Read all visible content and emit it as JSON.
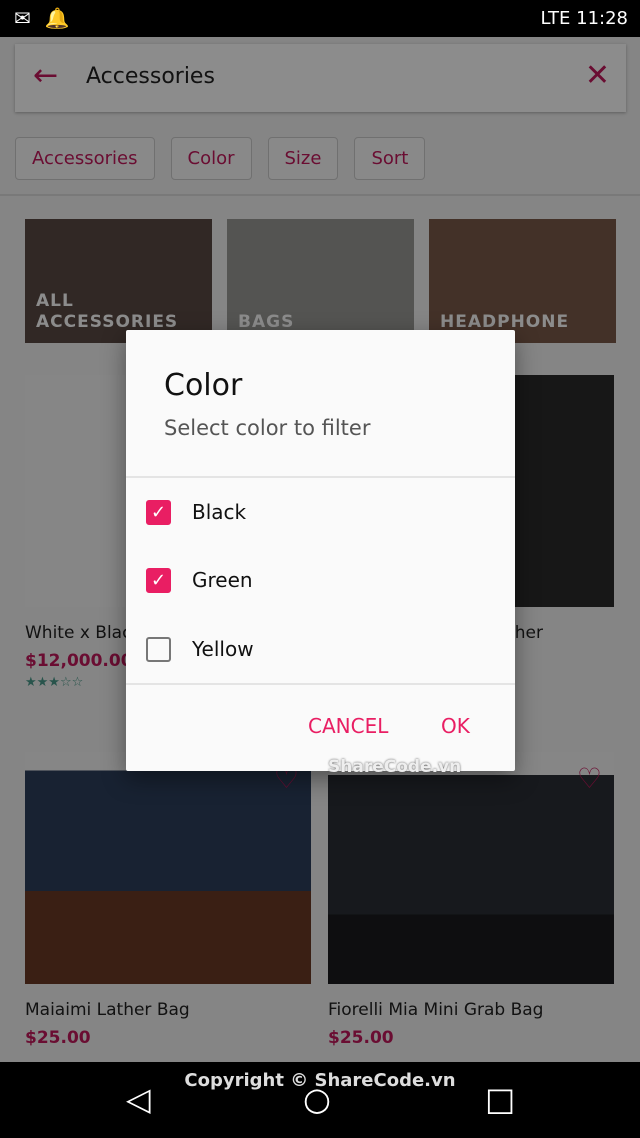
{
  "status": {
    "time": "11:28",
    "network": "LTE"
  },
  "appbar": {
    "title": "Accessories"
  },
  "chips": [
    "Accessories",
    "Color",
    "Size",
    "Sort"
  ],
  "categories": [
    "ALL ACCESSORIES",
    "BAGS",
    "HEADPHONE"
  ],
  "products": [
    {
      "title": "White x Black",
      "price": "$12,000.00",
      "rating": 3,
      "stars": "★★★☆☆"
    },
    {
      "title": "Leather",
      "price": "",
      "rating": null,
      "stars": ""
    },
    {
      "title": "Maiaimi Lather Bag",
      "price": "$25.00"
    },
    {
      "title": "Fiorelli Mia Mini Grab Bag",
      "price": "$25.00"
    }
  ],
  "dialog": {
    "title": "Color",
    "subtitle": "Select color to filter",
    "options": [
      {
        "label": "Black",
        "checked": true
      },
      {
        "label": "Green",
        "checked": true
      },
      {
        "label": "Yellow",
        "checked": false
      }
    ],
    "cancel": "CANCEL",
    "ok": "OK"
  },
  "watermark": "ShareCode.vn",
  "copyright": "Copyright © ShareCode.vn",
  "colors": {
    "accent": "#e91e63",
    "rating": "#4a9a8a"
  }
}
